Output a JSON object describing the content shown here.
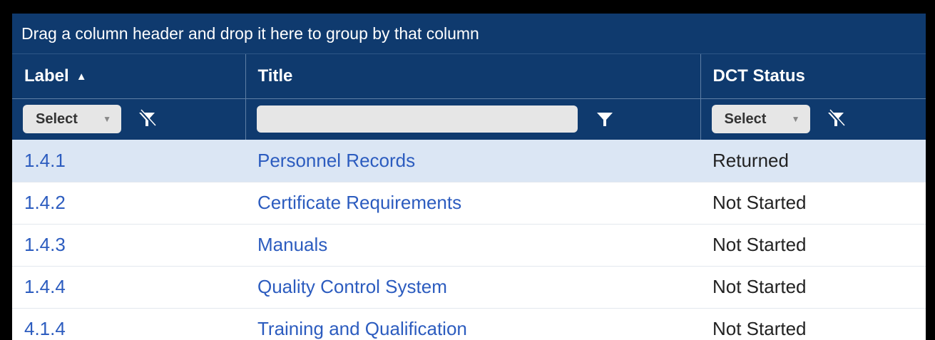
{
  "group_panel": {
    "text": "Drag a column header and drop it here to group by that column"
  },
  "columns": [
    {
      "label": "Label",
      "sort": "ascending"
    },
    {
      "label": "Title"
    },
    {
      "label": "DCT Status"
    }
  ],
  "filters": {
    "label_select": "Select",
    "title_filter_value": "",
    "status_select": "Select"
  },
  "rows": [
    {
      "label": "1.4.1",
      "title": "Personnel Records",
      "status": "Returned",
      "selected": true
    },
    {
      "label": "1.4.2",
      "title": "Certificate Requirements",
      "status": "Not Started"
    },
    {
      "label": "1.4.3",
      "title": "Manuals",
      "status": "Not Started"
    },
    {
      "label": "1.4.4",
      "title": "Quality Control System",
      "status": "Not Started"
    },
    {
      "label": "4.1.4",
      "title": "Training and Qualification",
      "status": "Not Started"
    }
  ],
  "colors": {
    "header_bg": "#0f3a6e",
    "link": "#2c5cbf",
    "selected_row": "#dbe6f4"
  },
  "icons": {
    "sort": "sort-ascending-icon",
    "filter_clear": "filter-clear-icon",
    "filter": "filter-icon"
  }
}
